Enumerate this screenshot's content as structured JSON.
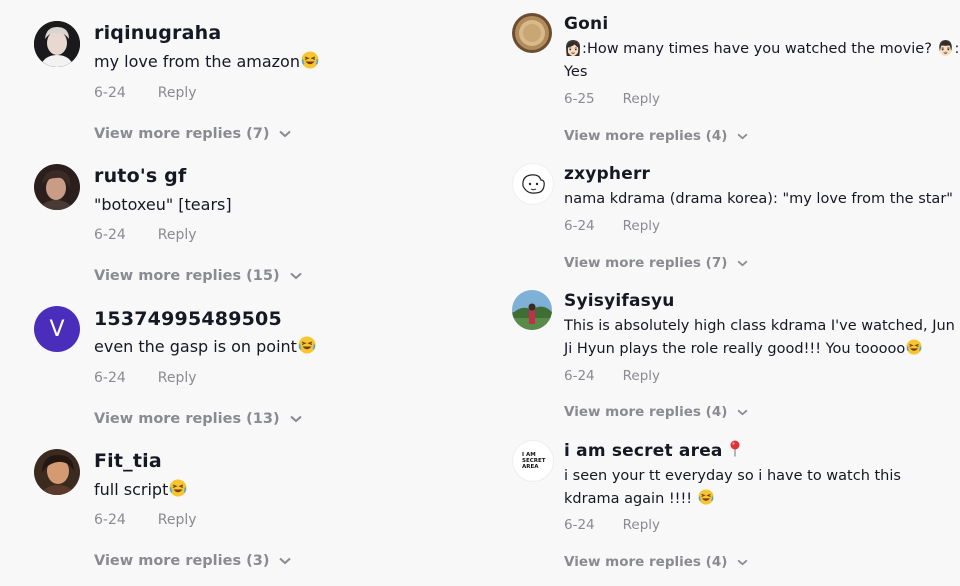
{
  "left_comments": [
    {
      "username": "riqinugraha",
      "text": "my love from the amazon",
      "date": "6-24",
      "reply": "Reply",
      "more": "View more replies (7)",
      "avatar": "photo-avatar-boy",
      "emoji": "laughing-emoji"
    },
    {
      "username": "ruto's gf",
      "text": "\"botoxeu\" [tears]",
      "date": "6-24",
      "reply": "Reply",
      "more": "View more replies (15)",
      "avatar": "photo-avatar-dark"
    },
    {
      "username": "15374995489505",
      "text": "even the gasp is on point",
      "date": "6-24",
      "reply": "Reply",
      "more": "View more replies (13)",
      "avatar_letter": "V",
      "avatar_color": "#4a2dbb",
      "emoji": "laughing-emoji"
    },
    {
      "username": "Fit_tia",
      "text": "full script",
      "date": "6-24",
      "reply": "Reply",
      "more": "View more replies (3)",
      "avatar": "photo-avatar-girl",
      "emoji": "laughing-emoji"
    }
  ],
  "right_comments": [
    {
      "username": "Goni",
      "text": "👩🏻:How many times have you watched the movie? 👨🏻: Yes",
      "date": "6-25",
      "reply": "Reply",
      "more": "View more replies (4)",
      "avatar": "photo-avatar-bread"
    },
    {
      "username": "zxypherr",
      "text": "nama kdrama (drama korea): \"my love from the star\"",
      "date": "6-24",
      "reply": "Reply",
      "more": "View more replies (7)",
      "avatar": "sketch-avatar"
    },
    {
      "username": "Syisyifasyu",
      "text": "This is absolutely high class kdrama I've watched, Jun Ji Hyun plays the role really good!!! You tooooo",
      "date": "6-24",
      "reply": "Reply",
      "more": "View more replies (4)",
      "avatar": "photo-avatar-beach",
      "emoji": "laughing-emoji"
    },
    {
      "username": "i am secret area",
      "text": "i seen your tt everyday so i have to watch this kdrama again !!!! ",
      "date": "6-24",
      "reply": "Reply",
      "more": "View more replies (4)",
      "avatar_text": "I AM SECRET AREA",
      "emoji": "laughing-emoji",
      "name_icon": "pushpin-icon"
    }
  ]
}
